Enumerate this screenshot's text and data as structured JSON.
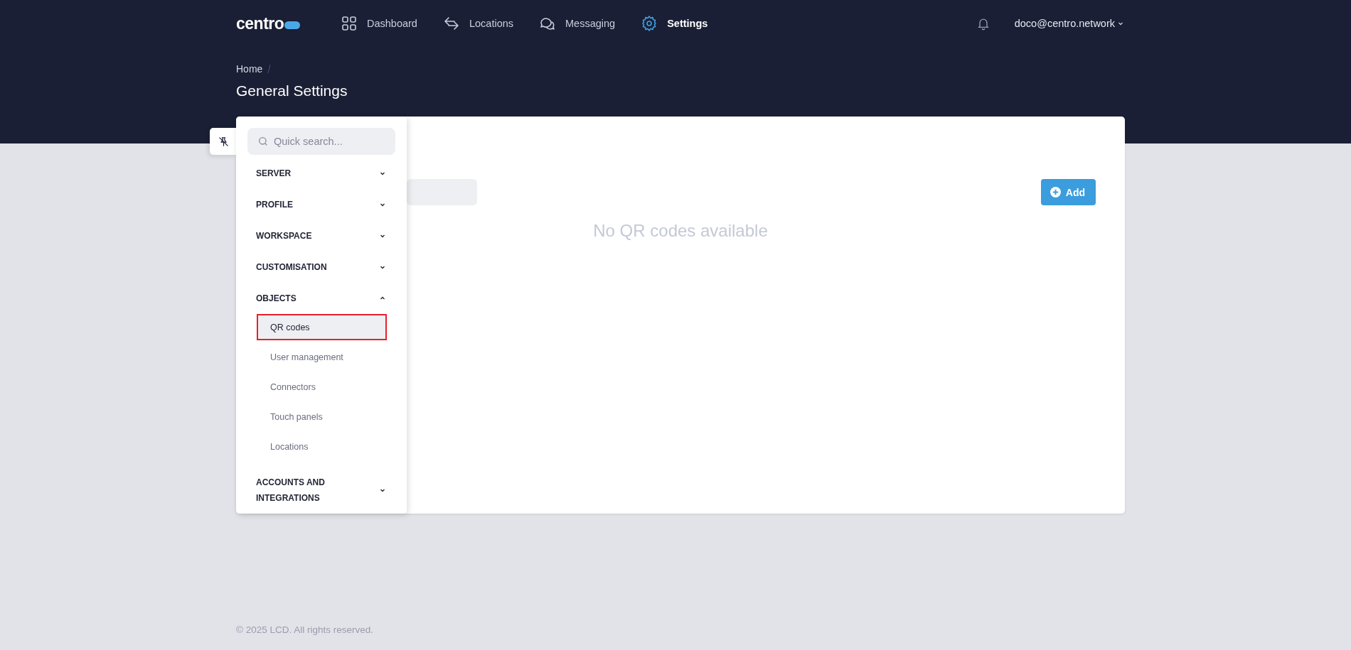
{
  "header": {
    "logo": "centro",
    "nav": [
      {
        "label": "Dashboard",
        "kind": "dashboard",
        "selected": false
      },
      {
        "label": "Locations",
        "kind": "locations",
        "selected": false
      },
      {
        "label": "Messaging",
        "kind": "messaging",
        "selected": false
      },
      {
        "label": "Settings",
        "kind": "settings",
        "selected": true
      }
    ],
    "user": "doco@centro.network"
  },
  "breadcrumb": [
    "Home"
  ],
  "page_title": "General Settings",
  "sidebar": {
    "search": {
      "placeholder": "Quick search..."
    },
    "sections": [
      {
        "label": "SERVER",
        "expanded": false
      },
      {
        "label": "PROFILE",
        "expanded": false
      },
      {
        "label": "WORKSPACE",
        "expanded": false
      },
      {
        "label": "CUSTOMISATION",
        "expanded": false
      },
      {
        "label": "OBJECTS",
        "expanded": true,
        "items": [
          {
            "label": "QR codes",
            "selected": true
          },
          {
            "label": "User management",
            "selected": false
          },
          {
            "label": "Connectors",
            "selected": false
          },
          {
            "label": "Touch panels",
            "selected": false
          },
          {
            "label": "Locations",
            "selected": false
          }
        ]
      },
      {
        "label": "ACCOUNTS AND INTEGRATIONS",
        "expanded": false
      }
    ]
  },
  "content": {
    "add_button": "Add",
    "empty_message": "No QR codes available"
  },
  "footer": "© 2025 LCD. All rights reserved."
}
